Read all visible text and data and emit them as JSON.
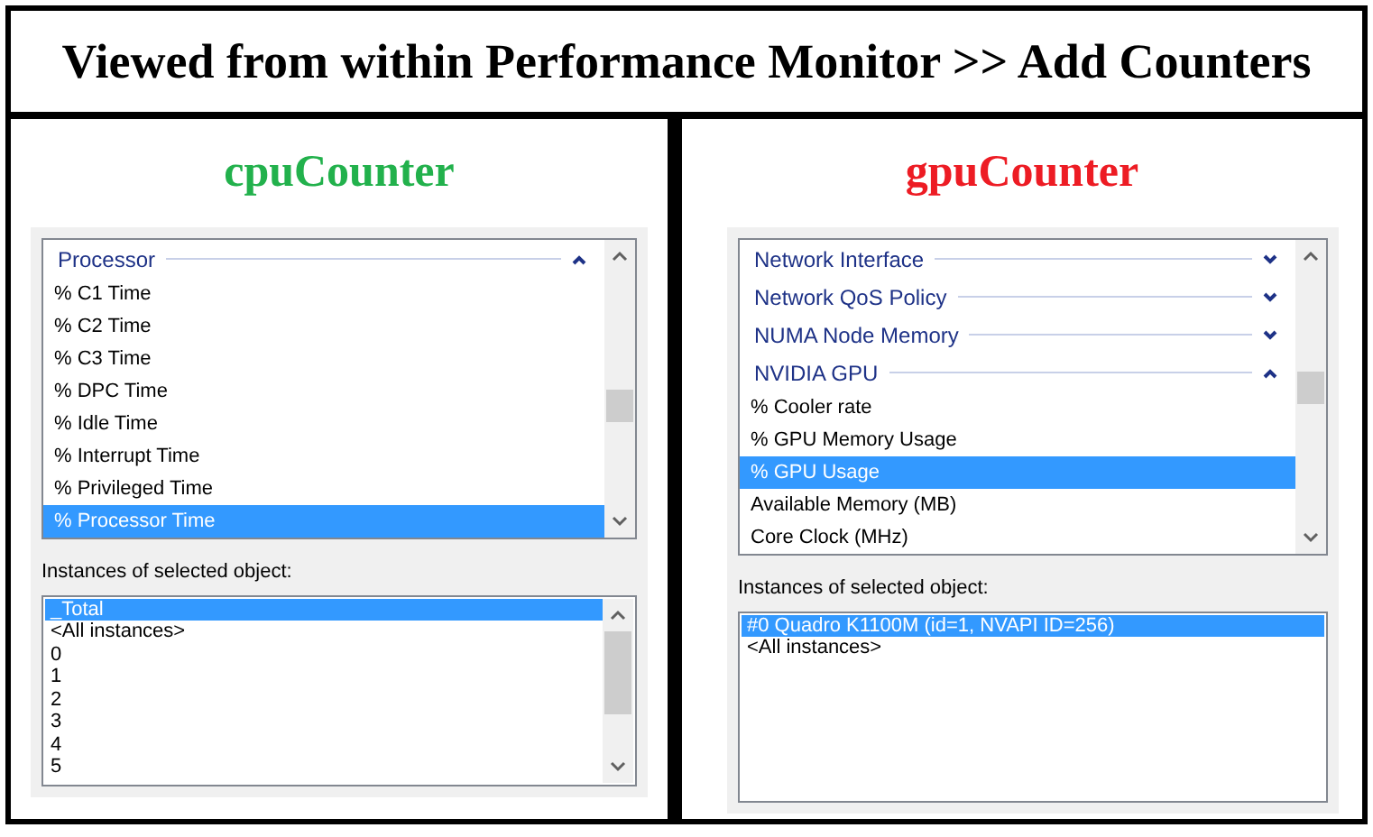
{
  "title": "Viewed from within Performance Monitor >> Add Counters",
  "panels": [
    {
      "heading": "cpuCounter",
      "color": "#22b14c",
      "counters": [
        {
          "kind": "category",
          "label": "Processor",
          "expanded": true
        },
        {
          "kind": "counter",
          "label": "% C1 Time",
          "selected": false
        },
        {
          "kind": "counter",
          "label": "% C2 Time",
          "selected": false
        },
        {
          "kind": "counter",
          "label": "% C3 Time",
          "selected": false
        },
        {
          "kind": "counter",
          "label": "% DPC Time",
          "selected": false
        },
        {
          "kind": "counter",
          "label": "% Idle Time",
          "selected": false
        },
        {
          "kind": "counter",
          "label": "% Interrupt Time",
          "selected": false
        },
        {
          "kind": "counter",
          "label": "% Privileged Time",
          "selected": false
        },
        {
          "kind": "counter",
          "label": "% Processor Time",
          "selected": true
        }
      ],
      "instances_label": "Instances of selected object:",
      "instances": [
        {
          "label": "_Total",
          "selected": true
        },
        {
          "label": "<All instances>",
          "selected": false
        },
        {
          "label": "0",
          "selected": false
        },
        {
          "label": "1",
          "selected": false
        },
        {
          "label": "2",
          "selected": false
        },
        {
          "label": "3",
          "selected": false
        },
        {
          "label": "4",
          "selected": false
        },
        {
          "label": "5",
          "selected": false
        }
      ]
    },
    {
      "heading": "gpuCounter",
      "color": "#ed1c24",
      "counters": [
        {
          "kind": "category",
          "label": "Network Interface",
          "expanded": false
        },
        {
          "kind": "category",
          "label": "Network QoS Policy",
          "expanded": false
        },
        {
          "kind": "category",
          "label": "NUMA Node Memory",
          "expanded": false
        },
        {
          "kind": "category",
          "label": "NVIDIA GPU",
          "expanded": true
        },
        {
          "kind": "counter",
          "label": "% Cooler rate",
          "selected": false
        },
        {
          "kind": "counter",
          "label": "% GPU Memory Usage",
          "selected": false
        },
        {
          "kind": "counter",
          "label": "% GPU Usage",
          "selected": true
        },
        {
          "kind": "counter",
          "label": "Available Memory (MB)",
          "selected": false
        },
        {
          "kind": "counter",
          "label": "Core Clock (MHz)",
          "selected": false
        }
      ],
      "instances_label": "Instances of selected object:",
      "instances": [
        {
          "label": "#0 Quadro K1100M (id=1, NVAPI ID=256)",
          "selected": true
        },
        {
          "label": "<All instances>",
          "selected": false
        }
      ]
    }
  ]
}
